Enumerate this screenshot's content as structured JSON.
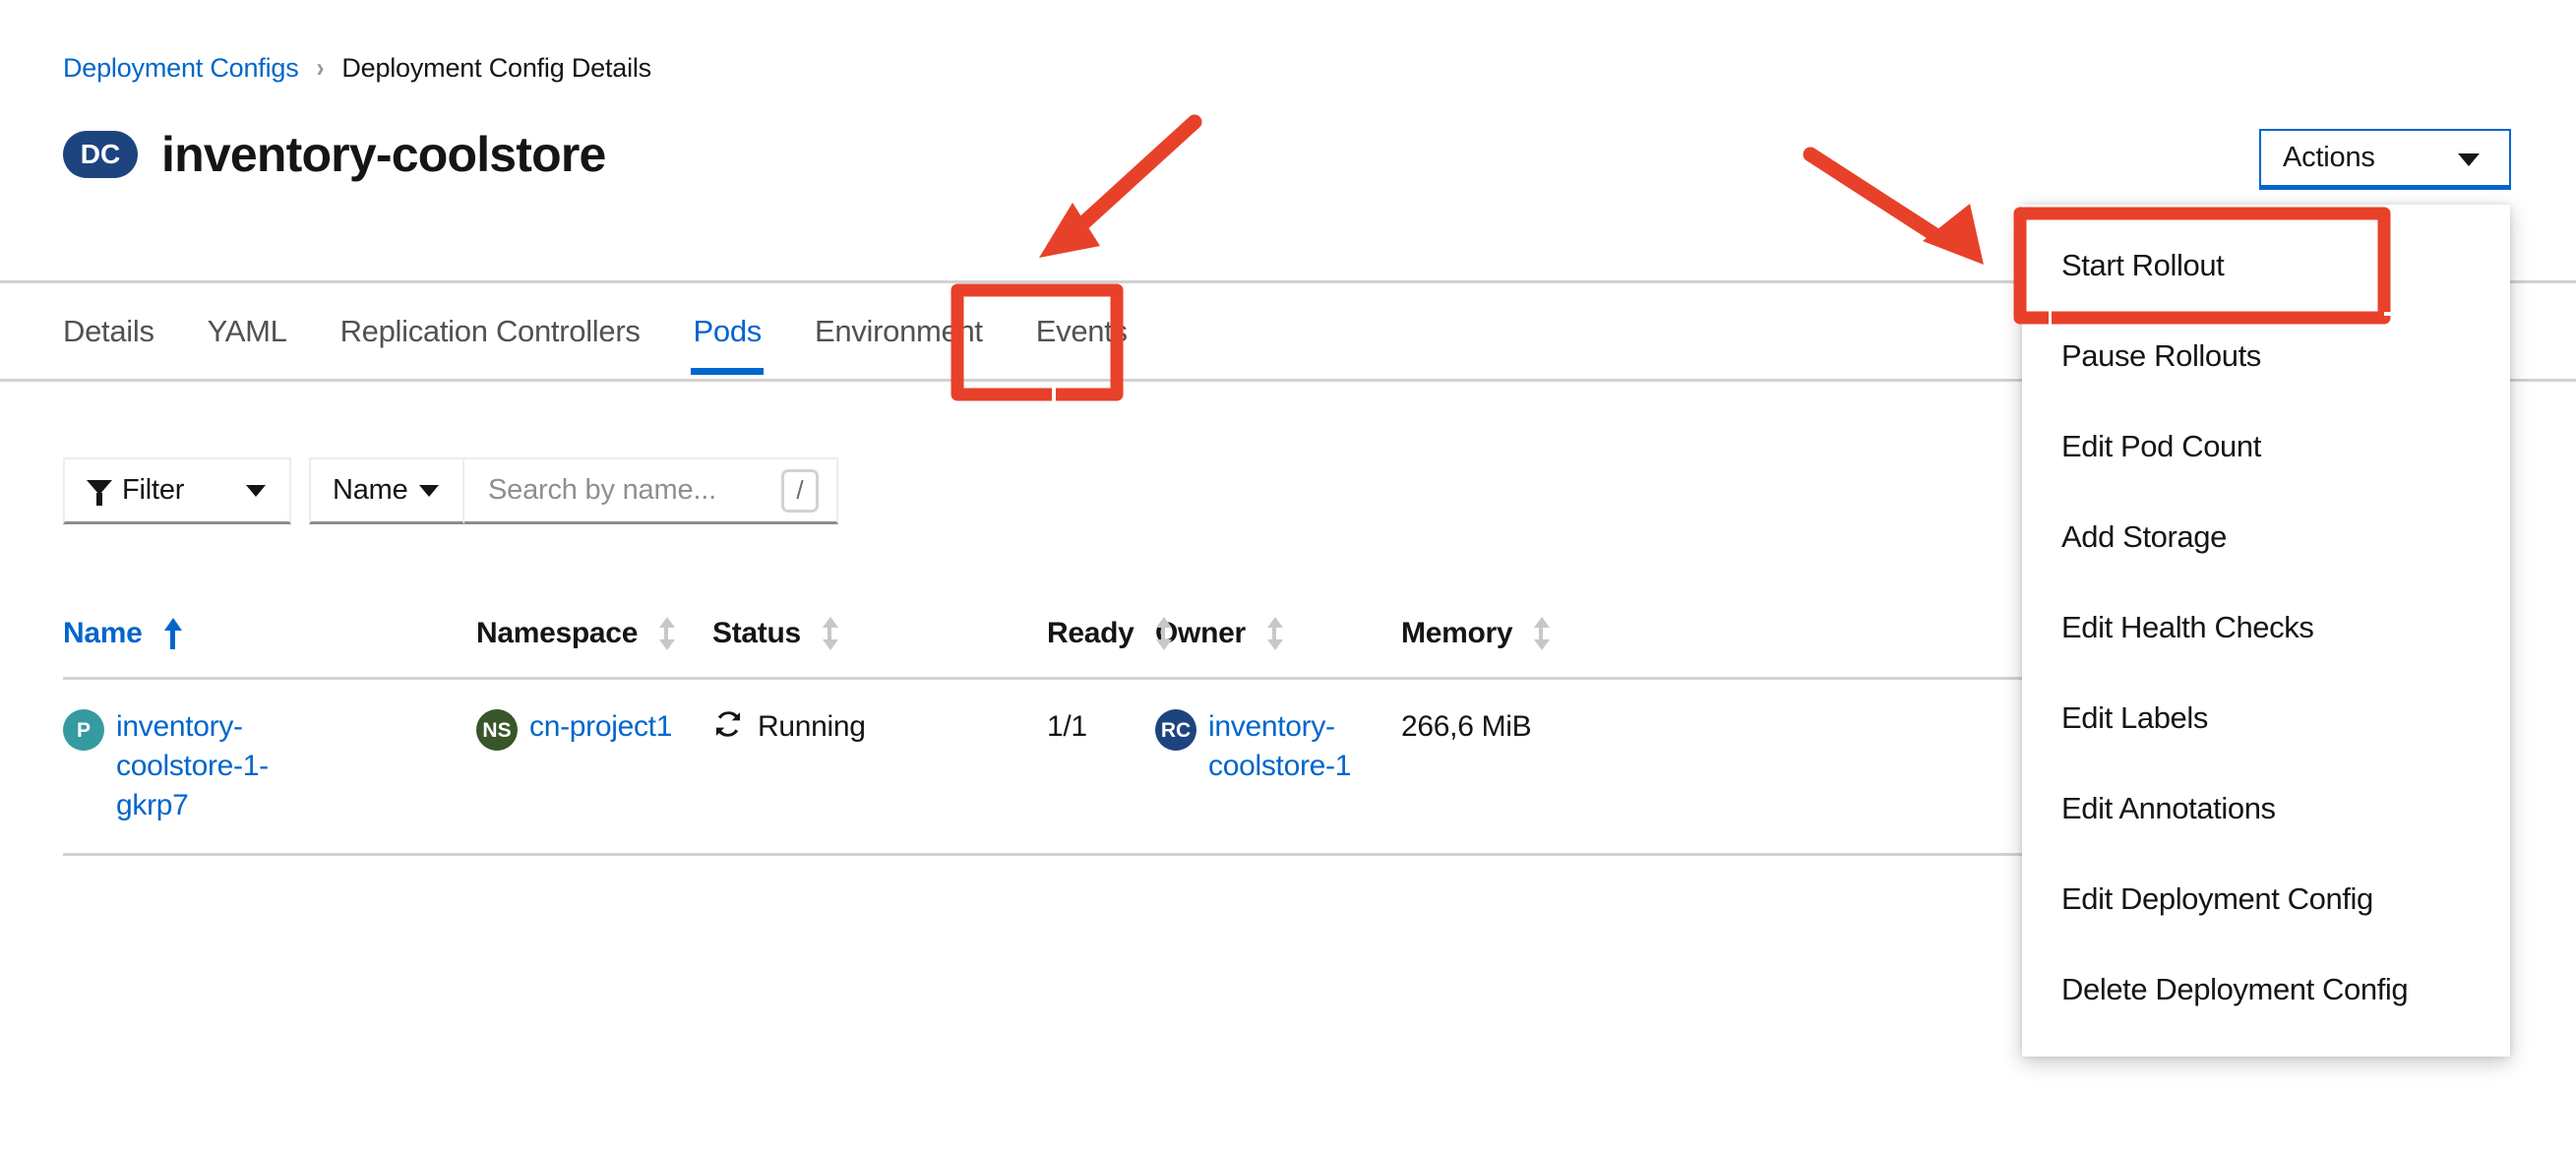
{
  "breadcrumb": {
    "parent": "Deployment Configs",
    "separator": "›",
    "current": "Deployment Config Details"
  },
  "header": {
    "badge": "DC",
    "title": "inventory-coolstore",
    "badge_color": "#1e4480"
  },
  "actions_button": {
    "label": "Actions",
    "icon": "chevron-down-icon",
    "border_color": "#0066cc"
  },
  "tabs": [
    {
      "label": "Details",
      "active": false
    },
    {
      "label": "YAML",
      "active": false
    },
    {
      "label": "Replication Controllers",
      "active": false
    },
    {
      "label": "Pods",
      "active": true
    },
    {
      "label": "Environment",
      "active": false
    },
    {
      "label": "Events",
      "active": false
    }
  ],
  "toolbar": {
    "filter_label": "Filter",
    "filter_icon": "funnel-icon",
    "filter_caret": "caret-down-icon",
    "attribute_label": "Name",
    "attribute_caret": "caret-down-icon",
    "search_value": "",
    "search_placeholder": "Search by name...",
    "shortcut_key": "/"
  },
  "table": {
    "columns": [
      {
        "label": "Name",
        "sort": "asc",
        "sorted": true
      },
      {
        "label": "Namespace",
        "sort": "none",
        "sorted": false
      },
      {
        "label": "Status",
        "sort": "none",
        "sorted": false
      },
      {
        "label": "Ready",
        "sort": "none",
        "sorted": false
      },
      {
        "label": "Owner",
        "sort": "none",
        "sorted": false
      },
      {
        "label": "Memory",
        "sort": "none",
        "sorted": false
      }
    ],
    "rows": [
      {
        "name": "inventory-coolstore-1-gkrp7",
        "name_badge": "P",
        "name_badge_color": "#359ba1",
        "namespace": "cn-project1",
        "namespace_badge": "NS",
        "namespace_badge_color": "#38562a",
        "status": "Running",
        "status_icon": "sync-icon",
        "ready": "1/1",
        "owner": "inventory-coolstore-1",
        "owner_badge": "RC",
        "owner_badge_color": "#1e4480",
        "memory": "266,6 MiB"
      }
    ]
  },
  "actions_menu": {
    "items": [
      "Start Rollout",
      "Pause Rollouts",
      "Edit Pod Count",
      "Add Storage",
      "Edit Health Checks",
      "Edit Labels",
      "Edit Annotations",
      "Edit Deployment Config",
      "Delete Deployment Config"
    ]
  },
  "annotations": {
    "color": "#e8412a",
    "highlight_rect_tab": "Pods",
    "highlight_rect_menu_item": "Start Rollout",
    "arrows": 2
  }
}
